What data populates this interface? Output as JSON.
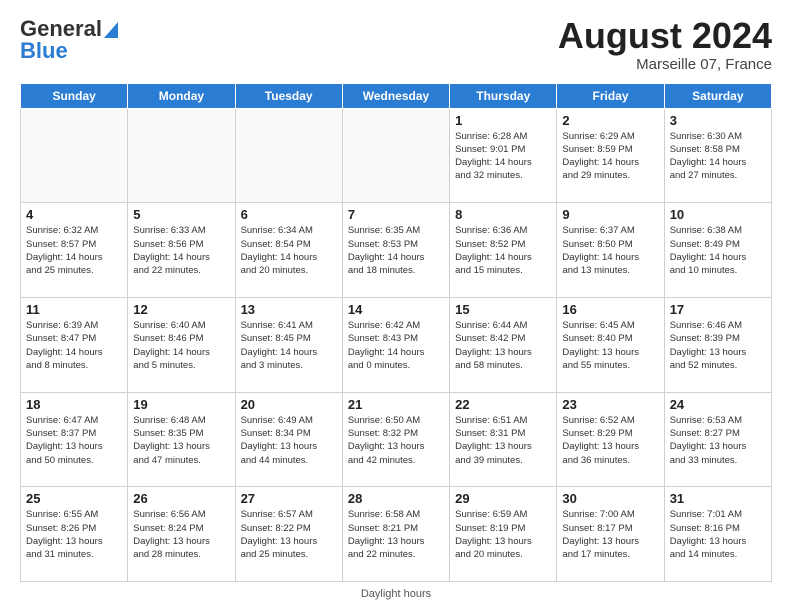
{
  "header": {
    "logo_general": "General",
    "logo_blue": "Blue",
    "month_year": "August 2024",
    "location": "Marseille 07, France"
  },
  "footer": {
    "daylight_label": "Daylight hours"
  },
  "weekdays": [
    "Sunday",
    "Monday",
    "Tuesday",
    "Wednesday",
    "Thursday",
    "Friday",
    "Saturday"
  ],
  "weeks": [
    [
      {
        "day": "",
        "info": ""
      },
      {
        "day": "",
        "info": ""
      },
      {
        "day": "",
        "info": ""
      },
      {
        "day": "",
        "info": ""
      },
      {
        "day": "1",
        "info": "Sunrise: 6:28 AM\nSunset: 9:01 PM\nDaylight: 14 hours\nand 32 minutes."
      },
      {
        "day": "2",
        "info": "Sunrise: 6:29 AM\nSunset: 8:59 PM\nDaylight: 14 hours\nand 29 minutes."
      },
      {
        "day": "3",
        "info": "Sunrise: 6:30 AM\nSunset: 8:58 PM\nDaylight: 14 hours\nand 27 minutes."
      }
    ],
    [
      {
        "day": "4",
        "info": "Sunrise: 6:32 AM\nSunset: 8:57 PM\nDaylight: 14 hours\nand 25 minutes."
      },
      {
        "day": "5",
        "info": "Sunrise: 6:33 AM\nSunset: 8:56 PM\nDaylight: 14 hours\nand 22 minutes."
      },
      {
        "day": "6",
        "info": "Sunrise: 6:34 AM\nSunset: 8:54 PM\nDaylight: 14 hours\nand 20 minutes."
      },
      {
        "day": "7",
        "info": "Sunrise: 6:35 AM\nSunset: 8:53 PM\nDaylight: 14 hours\nand 18 minutes."
      },
      {
        "day": "8",
        "info": "Sunrise: 6:36 AM\nSunset: 8:52 PM\nDaylight: 14 hours\nand 15 minutes."
      },
      {
        "day": "9",
        "info": "Sunrise: 6:37 AM\nSunset: 8:50 PM\nDaylight: 14 hours\nand 13 minutes."
      },
      {
        "day": "10",
        "info": "Sunrise: 6:38 AM\nSunset: 8:49 PM\nDaylight: 14 hours\nand 10 minutes."
      }
    ],
    [
      {
        "day": "11",
        "info": "Sunrise: 6:39 AM\nSunset: 8:47 PM\nDaylight: 14 hours\nand 8 minutes."
      },
      {
        "day": "12",
        "info": "Sunrise: 6:40 AM\nSunset: 8:46 PM\nDaylight: 14 hours\nand 5 minutes."
      },
      {
        "day": "13",
        "info": "Sunrise: 6:41 AM\nSunset: 8:45 PM\nDaylight: 14 hours\nand 3 minutes."
      },
      {
        "day": "14",
        "info": "Sunrise: 6:42 AM\nSunset: 8:43 PM\nDaylight: 14 hours\nand 0 minutes."
      },
      {
        "day": "15",
        "info": "Sunrise: 6:44 AM\nSunset: 8:42 PM\nDaylight: 13 hours\nand 58 minutes."
      },
      {
        "day": "16",
        "info": "Sunrise: 6:45 AM\nSunset: 8:40 PM\nDaylight: 13 hours\nand 55 minutes."
      },
      {
        "day": "17",
        "info": "Sunrise: 6:46 AM\nSunset: 8:39 PM\nDaylight: 13 hours\nand 52 minutes."
      }
    ],
    [
      {
        "day": "18",
        "info": "Sunrise: 6:47 AM\nSunset: 8:37 PM\nDaylight: 13 hours\nand 50 minutes."
      },
      {
        "day": "19",
        "info": "Sunrise: 6:48 AM\nSunset: 8:35 PM\nDaylight: 13 hours\nand 47 minutes."
      },
      {
        "day": "20",
        "info": "Sunrise: 6:49 AM\nSunset: 8:34 PM\nDaylight: 13 hours\nand 44 minutes."
      },
      {
        "day": "21",
        "info": "Sunrise: 6:50 AM\nSunset: 8:32 PM\nDaylight: 13 hours\nand 42 minutes."
      },
      {
        "day": "22",
        "info": "Sunrise: 6:51 AM\nSunset: 8:31 PM\nDaylight: 13 hours\nand 39 minutes."
      },
      {
        "day": "23",
        "info": "Sunrise: 6:52 AM\nSunset: 8:29 PM\nDaylight: 13 hours\nand 36 minutes."
      },
      {
        "day": "24",
        "info": "Sunrise: 6:53 AM\nSunset: 8:27 PM\nDaylight: 13 hours\nand 33 minutes."
      }
    ],
    [
      {
        "day": "25",
        "info": "Sunrise: 6:55 AM\nSunset: 8:26 PM\nDaylight: 13 hours\nand 31 minutes."
      },
      {
        "day": "26",
        "info": "Sunrise: 6:56 AM\nSunset: 8:24 PM\nDaylight: 13 hours\nand 28 minutes."
      },
      {
        "day": "27",
        "info": "Sunrise: 6:57 AM\nSunset: 8:22 PM\nDaylight: 13 hours\nand 25 minutes."
      },
      {
        "day": "28",
        "info": "Sunrise: 6:58 AM\nSunset: 8:21 PM\nDaylight: 13 hours\nand 22 minutes."
      },
      {
        "day": "29",
        "info": "Sunrise: 6:59 AM\nSunset: 8:19 PM\nDaylight: 13 hours\nand 20 minutes."
      },
      {
        "day": "30",
        "info": "Sunrise: 7:00 AM\nSunset: 8:17 PM\nDaylight: 13 hours\nand 17 minutes."
      },
      {
        "day": "31",
        "info": "Sunrise: 7:01 AM\nSunset: 8:16 PM\nDaylight: 13 hours\nand 14 minutes."
      }
    ]
  ]
}
